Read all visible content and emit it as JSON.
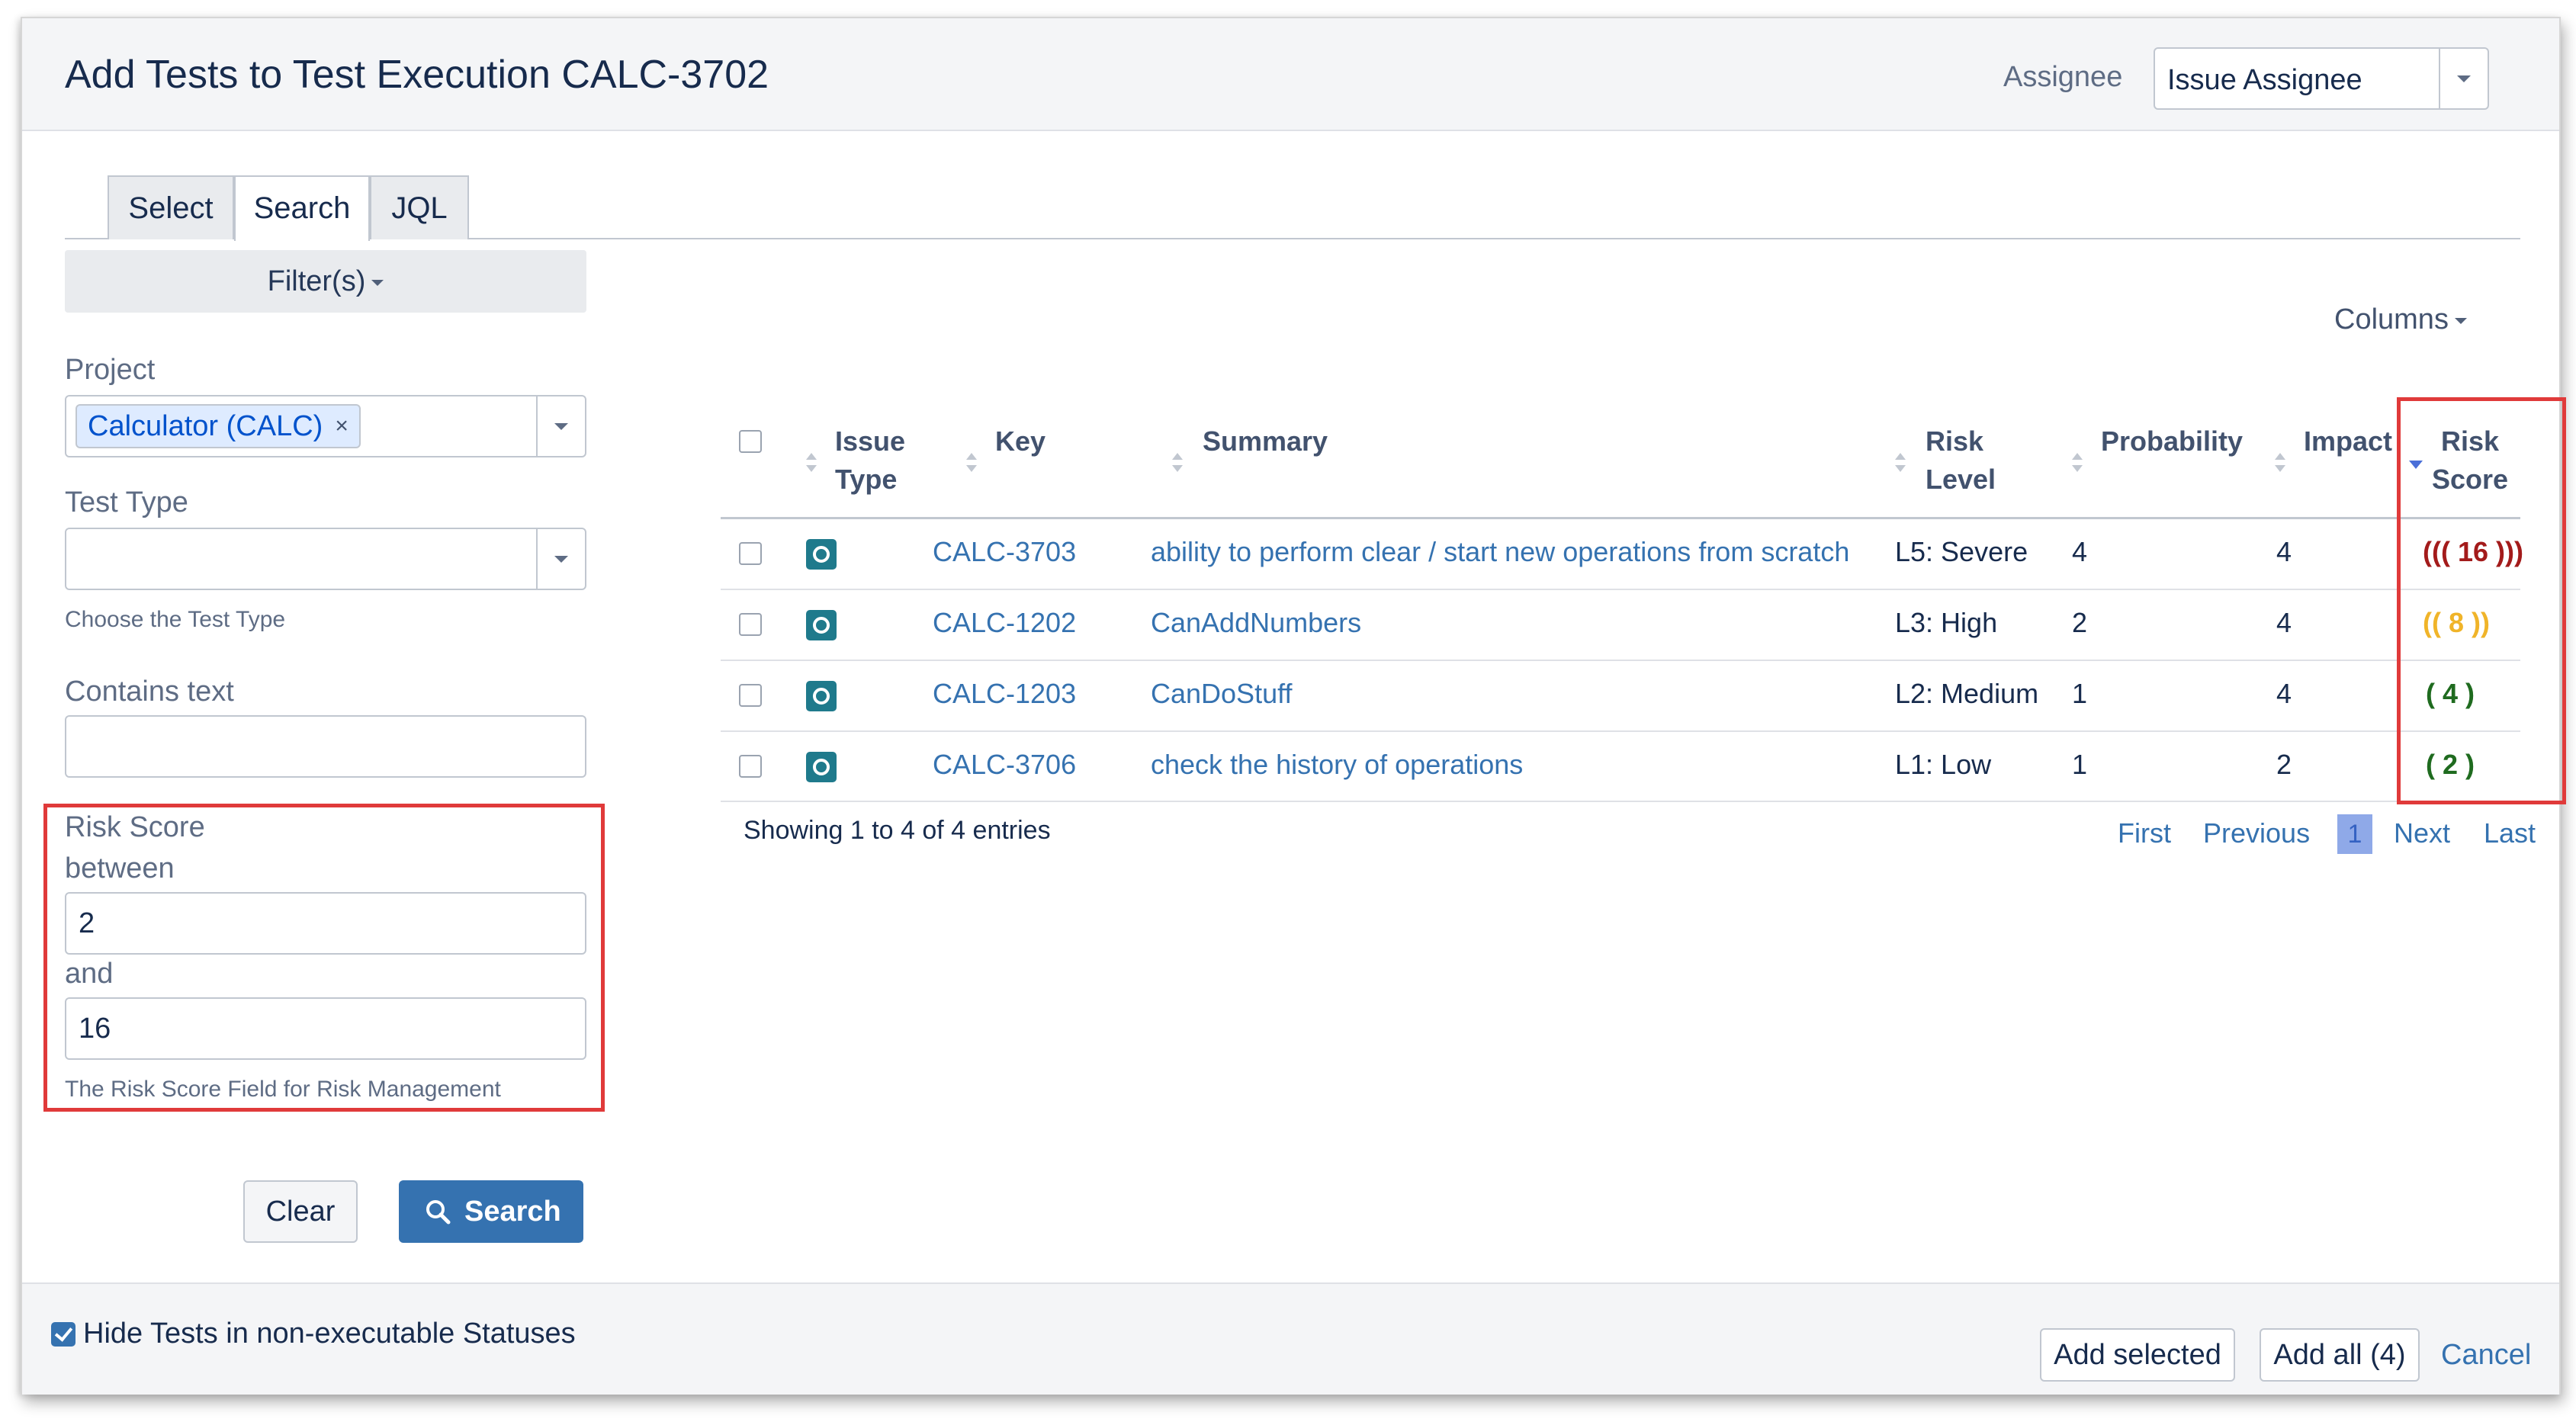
{
  "dialog": {
    "title": "Add Tests to Test Execution CALC-3702",
    "assignee_label": "Assignee",
    "assignee_value": "Issue Assignee"
  },
  "tabs": [
    {
      "label": "Select",
      "active": false
    },
    {
      "label": "Search",
      "active": true
    },
    {
      "label": "JQL",
      "active": false
    }
  ],
  "filters": {
    "filters_button": "Filter(s)",
    "project_label": "Project",
    "project_value": "Calculator (CALC)",
    "project_remove": "×",
    "test_type_label": "Test Type",
    "test_type_value": "",
    "test_type_help": "Choose the Test Type",
    "contains_text_label": "Contains text",
    "contains_text_value": "",
    "risk_score_label": "Risk Score",
    "between_label": "between",
    "between_value": "2",
    "and_label": "and",
    "and_value": "16",
    "risk_help": "The Risk Score Field for Risk Management",
    "clear_button": "Clear",
    "search_button": "Search"
  },
  "table": {
    "columns_button": "Columns",
    "headers": {
      "issue_type": [
        "Issue",
        "Type"
      ],
      "key": "Key",
      "summary": "Summary",
      "risk_level": [
        "Risk",
        "Level"
      ],
      "probability": "Probability",
      "impact": "Impact",
      "risk_score": [
        "Risk",
        "Score"
      ]
    },
    "rows": [
      {
        "key": "CALC-3703",
        "summary": "ability to perform clear / start new operations from scratch",
        "risk_level": "L5: Severe",
        "probability": "4",
        "impact": "4",
        "risk_score": "((( 16 )))",
        "score_color": "#a31b1b"
      },
      {
        "key": "CALC-1202",
        "summary": "CanAddNumbers",
        "risk_level": "L3: High",
        "probability": "2",
        "impact": "4",
        "risk_score": "(( 8 ))",
        "score_color": "#f0b429"
      },
      {
        "key": "CALC-1203",
        "summary": "CanDoStuff",
        "risk_level": "L2: Medium",
        "probability": "1",
        "impact": "4",
        "risk_score": "( 4 )",
        "score_color": "#1f6b1f"
      },
      {
        "key": "CALC-3706",
        "summary": "check the history of operations",
        "risk_level": "L1: Low",
        "probability": "1",
        "impact": "2",
        "risk_score": "( 2 )",
        "score_color": "#1f6b1f"
      }
    ],
    "showing": "Showing 1 to 4 of 4 entries",
    "pagination": {
      "first": "First",
      "previous": "Previous",
      "current": "1",
      "next": "Next",
      "last": "Last"
    }
  },
  "footer": {
    "hide_label": "Hide Tests in non-executable Statuses",
    "hide_checked": true,
    "add_selected": "Add selected",
    "add_all": "Add all (4)",
    "cancel": "Cancel"
  },
  "colors": {
    "primary": "#3572b0",
    "link": "#3572b0",
    "highlight_box": "#e03a3a",
    "test_icon": "#1f7a8c"
  },
  "icons": {
    "test_type": "test-issue-type-icon",
    "search": "search-icon",
    "dropdown": "chevron-down-icon",
    "checked": "checkbox-checked-icon"
  }
}
